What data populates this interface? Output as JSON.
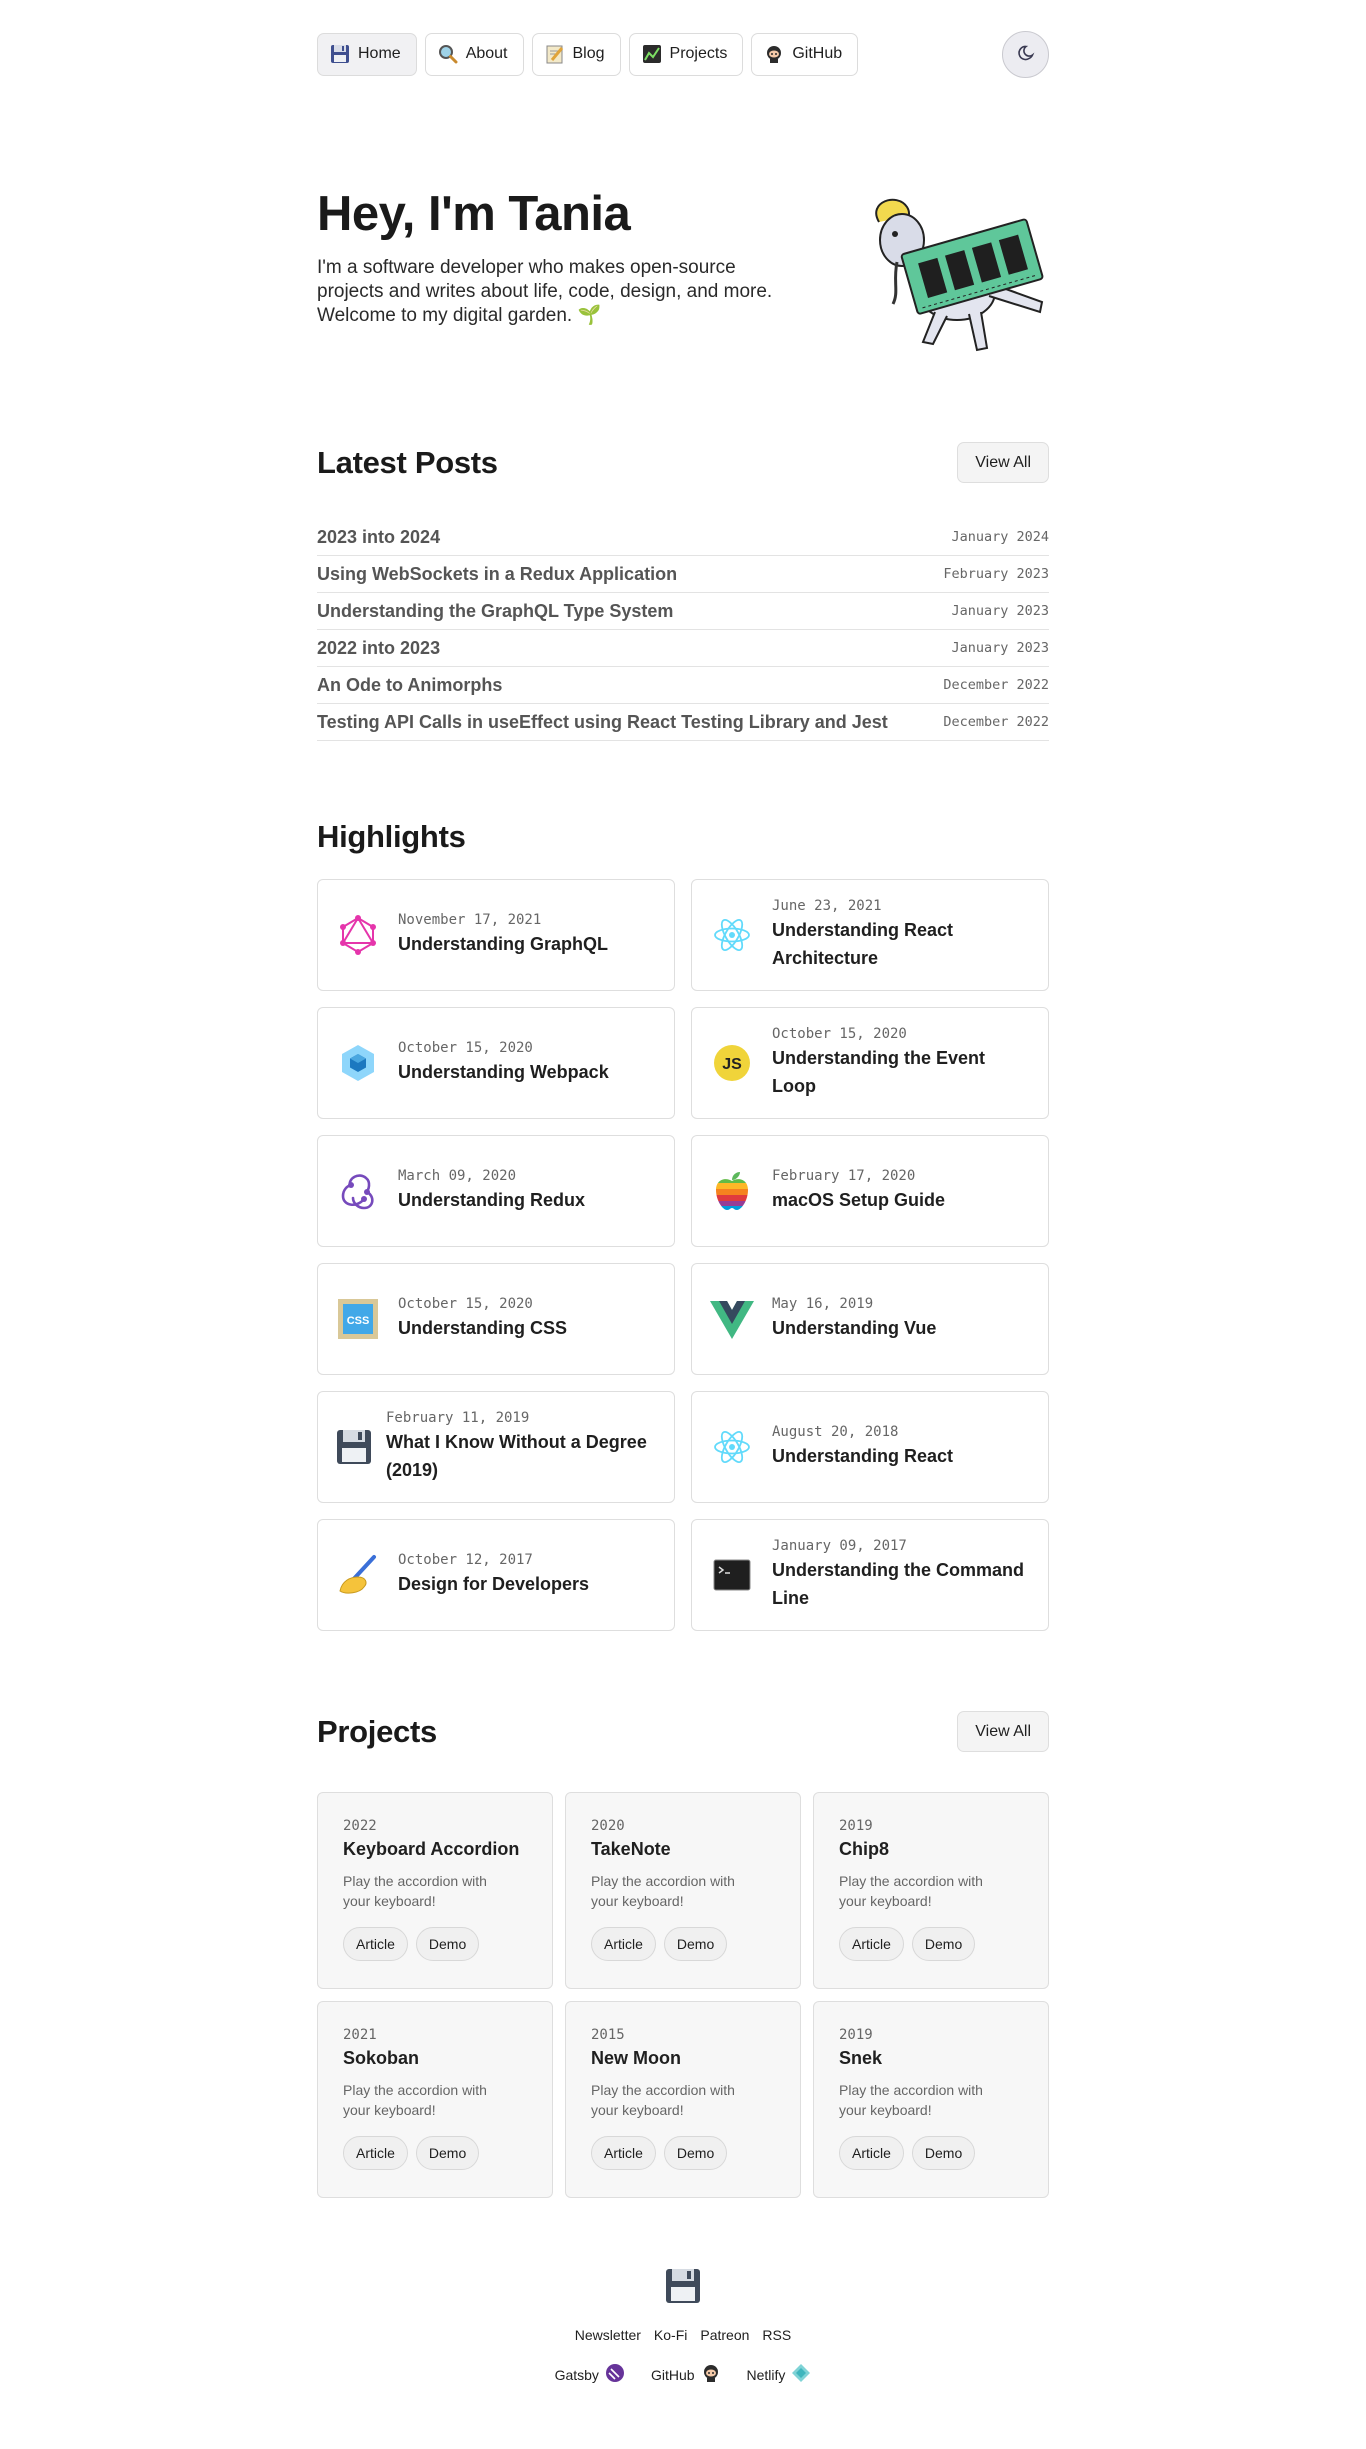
{
  "nav": {
    "items": [
      {
        "label": "Home",
        "icon": "floppy-disk-icon",
        "active": true
      },
      {
        "label": "About",
        "icon": "magnifying-glass-icon",
        "active": false
      },
      {
        "label": "Blog",
        "icon": "memo-icon",
        "active": false
      },
      {
        "label": "Projects",
        "icon": "chart-icon",
        "active": false
      },
      {
        "label": "GitHub",
        "icon": "octocat-icon",
        "active": false
      }
    ],
    "theme_toggle_icon": "moon-icon"
  },
  "hero": {
    "title": "Hey, I'm Tania",
    "subtitle": "I'm a software developer who makes open-source projects and writes about life, code, design, and more. Welcome to my digital garden. 🌱",
    "art_icon": "ram-with-ram-stick-illustration"
  },
  "latest_posts": {
    "title": "Latest Posts",
    "view_all": "View All",
    "items": [
      {
        "title": "2023 into 2024",
        "date": "January 2024"
      },
      {
        "title": "Using WebSockets in a Redux Application",
        "date": "February 2023"
      },
      {
        "title": "Understanding the GraphQL Type System",
        "date": "January 2023"
      },
      {
        "title": "2022 into 2023",
        "date": "January 2023"
      },
      {
        "title": "An Ode to Animorphs",
        "date": "December 2022"
      },
      {
        "title": "Testing API Calls in useEffect using React Testing Library and Jest",
        "date": "December 2022"
      }
    ]
  },
  "highlights": {
    "title": "Highlights",
    "items": [
      {
        "date": "November 17, 2021",
        "title": "Understanding GraphQL",
        "icon": "graphql-icon"
      },
      {
        "date": "June 23, 2021",
        "title": "Understanding React Architecture",
        "icon": "react-icon"
      },
      {
        "date": "October 15, 2020",
        "title": "Understanding Webpack",
        "icon": "webpack-icon"
      },
      {
        "date": "October 15, 2020",
        "title": "Understanding the Event Loop",
        "icon": "javascript-icon"
      },
      {
        "date": "March 09, 2020",
        "title": "Understanding Redux",
        "icon": "redux-icon"
      },
      {
        "date": "February 17, 2020",
        "title": "macOS Setup Guide",
        "icon": "apple-icon"
      },
      {
        "date": "October 15, 2020",
        "title": "Understanding CSS",
        "icon": "css-icon"
      },
      {
        "date": "May 16, 2019",
        "title": "Understanding Vue",
        "icon": "vue-icon"
      },
      {
        "date": "February 11, 2019",
        "title": "What I Know Without a Degree (2019)",
        "icon": "floppy-disk-icon"
      },
      {
        "date": "August 20, 2018",
        "title": "Understanding React",
        "icon": "react-icon"
      },
      {
        "date": "October 12, 2017",
        "title": "Design for Developers",
        "icon": "writing-hand-icon"
      },
      {
        "date": "January 09, 2017",
        "title": "Understanding the Command Line",
        "icon": "terminal-icon"
      }
    ]
  },
  "projects": {
    "title": "Projects",
    "view_all": "View All",
    "items": [
      {
        "year": "2022",
        "title": "Keyboard Accordion",
        "desc": "Play the accordion with your keyboard!",
        "article": "Article",
        "demo": "Demo"
      },
      {
        "year": "2020",
        "title": "TakeNote",
        "desc": "Play the accordion with your keyboard!",
        "article": "Article",
        "demo": "Demo"
      },
      {
        "year": "2019",
        "title": "Chip8",
        "desc": "Play the accordion with your keyboard!",
        "article": "Article",
        "demo": "Demo"
      },
      {
        "year": "2021",
        "title": "Sokoban",
        "desc": "Play the accordion with your keyboard!",
        "article": "Article",
        "demo": "Demo"
      },
      {
        "year": "2015",
        "title": "New Moon",
        "desc": "Play the accordion with your keyboard!",
        "article": "Article",
        "demo": "Demo"
      },
      {
        "year": "2019",
        "title": "Snek",
        "desc": "Play the accordion with your keyboard!",
        "article": "Article",
        "demo": "Demo"
      }
    ]
  },
  "footer": {
    "logo_icon": "floppy-disk-icon",
    "links": [
      "Newsletter",
      "Ko-Fi",
      "Patreon",
      "RSS"
    ],
    "built_with": [
      {
        "label": "Gatsby",
        "icon": "gatsby-icon"
      },
      {
        "label": "GitHub",
        "icon": "octocat-icon"
      },
      {
        "label": "Netlify",
        "icon": "netlify-icon"
      }
    ]
  }
}
